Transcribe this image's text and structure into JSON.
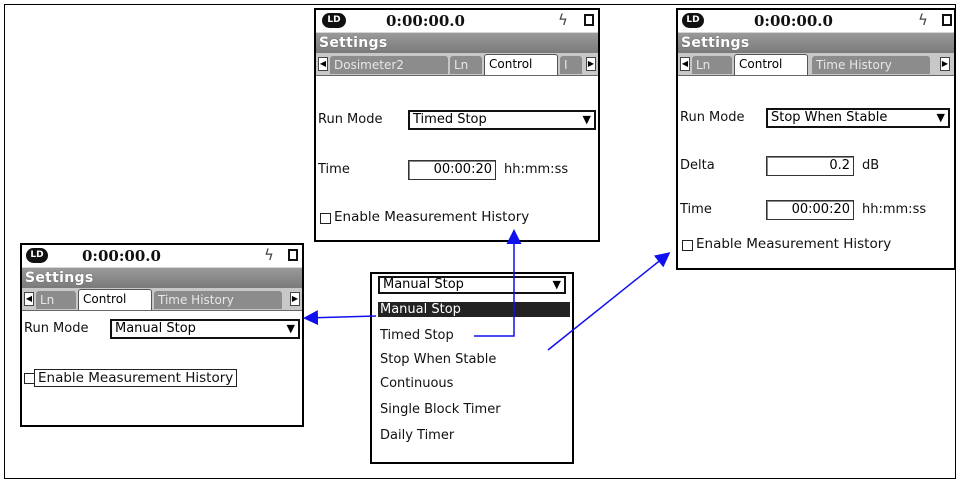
{
  "status": {
    "time": "0:00:00.0",
    "logo_text": "LD"
  },
  "common": {
    "settings_title": "Settings",
    "run_mode_label": "Run Mode",
    "enable_history_label": "Enable Measurement History"
  },
  "panel_manual": {
    "tabs": [
      "Ln",
      "Control",
      "Time History"
    ],
    "run_mode_value": "Manual Stop"
  },
  "panel_timed": {
    "tabs": [
      "Dosimeter2",
      "Ln",
      "Control",
      "I"
    ],
    "run_mode_value": "Timed Stop",
    "time_label": "Time",
    "time_value": "00:00:20",
    "time_unit": "hh:mm:ss"
  },
  "panel_stable": {
    "tabs": [
      "Ln",
      "Control",
      "Time History"
    ],
    "run_mode_value": "Stop When Stable",
    "delta_label": "Delta",
    "delta_value": "0.2",
    "delta_unit": "dB",
    "time_label": "Time",
    "time_value": "00:00:20",
    "time_unit": "hh:mm:ss"
  },
  "dropdown": {
    "current_value": "Manual Stop",
    "options": [
      "Manual Stop",
      "Timed Stop",
      "Stop When Stable",
      "Continuous",
      "Single Block Timer",
      "Daily Timer"
    ]
  },
  "colors": {
    "arrow": "#1010ee",
    "title_bar": "#8a8a8a",
    "inactive_tab": "#8c8c8c"
  }
}
